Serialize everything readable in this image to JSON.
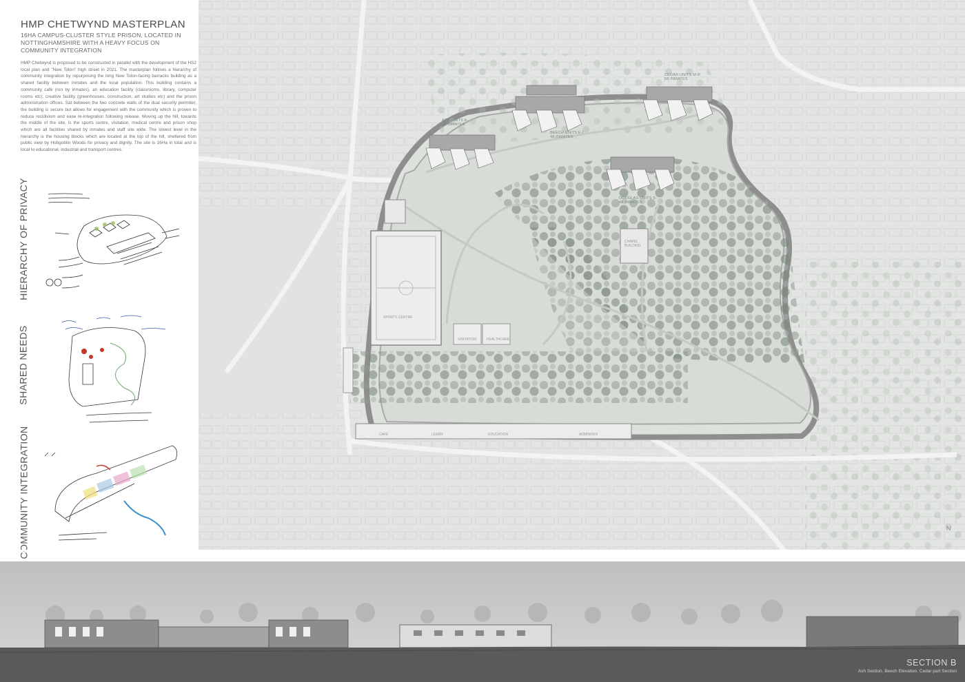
{
  "title": "HMP CHETWYND MASTERPLAN",
  "subtitle": "16Ha CAMPUS-CLUSTER STYLE PRISON, LOCATED IN NOTTINGHAMSHIRE WITH A HEAVY FOCUS ON COMMUNITY INTEGRATION",
  "description": "HMP Chetwynd is proposed to be constructed in parallel with the development of the HS2 local plan and \"New Toton\" high street in 2021. The masterplan follows a hierarchy of community integration by repurposing the long New Toton-facing barracks building as a shared facility between inmates and the local population. This building contains a community cafe (run by inmates), an education facility (classrooms, library, computer rooms etc), creative facility (greenhouses, construction, art studios etc) and the prison administration offices. Sat between the two concrete walls of the dual security perimiter, the building is secure but allows for engagement with the community which is proven to reduce recidivism and ease re-integration following release. Moving up the hill, towards the middle of the site, is the sports centre, visitation, medical centre and prison shop which are all facilities shared by inmates and staff site wide. The lowest level in the hierarchy is the housing blocks which are located at the top of the hill, sheltered from public view by Hobgoblin Woods for privacy and dignity. The site is 16Ha in total and is local to educational, industrial and transport centres.",
  "side_labels": {
    "privacy": "HIERARCHY OF PRIVACY",
    "shared": "SHARED NEEDS",
    "community": "COMMUNITY INTEGRATION"
  },
  "map_labels": {
    "ash": "ASH UNITS A-\n48 INMATES",
    "beech": "BEECH UNITS E-I\n48 INMATES",
    "cedar": "CEDAR UNITS M-R\n58 INMATES",
    "douglas": "DOUGLAS UNITS S-\n48 INMATES",
    "sports": "SPORTS CENTRE",
    "chapel": "CHAPEL\nBUILDING",
    "visitation": "VISITATION",
    "health": "HEALTHCARE",
    "cafe": "CAFE",
    "learn": "LEARN",
    "education": "EDUCATION",
    "admin": "ADMIN/OFF"
  },
  "section": {
    "title": "SECTION B",
    "subtitle": "Ash Section, Beech Elevation, Cedar part Section"
  },
  "colors": {
    "map_background": "#e3e5e3",
    "site_fill": "#d9ddd8",
    "tree_green": "#7a8a7c",
    "wall_grey": "#8e8e8e",
    "section_sky": "#c9c9c9",
    "ground": "#5a5a5a"
  }
}
